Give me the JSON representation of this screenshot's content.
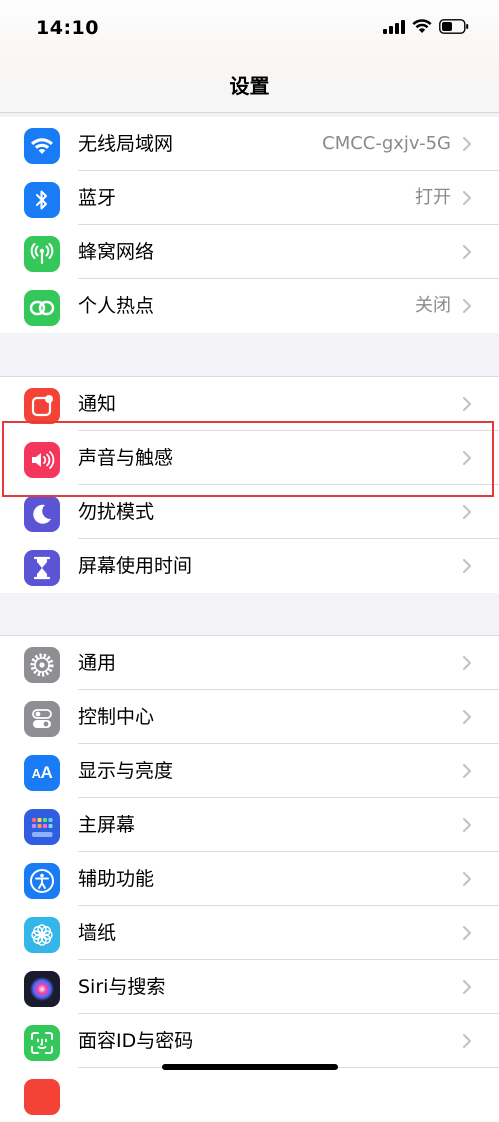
{
  "status": {
    "time": "14:10"
  },
  "nav": {
    "title": "设置"
  },
  "group1": [
    {
      "label": "无线局域网",
      "value": "CMCC-gxjv-5G",
      "icon": "wifi-icon",
      "color": "#1a7cf5"
    },
    {
      "label": "蓝牙",
      "value": "打开",
      "icon": "bluetooth-icon",
      "color": "#1a7cf5"
    },
    {
      "label": "蜂窝网络",
      "value": "",
      "icon": "antenna-icon",
      "color": "#34c759"
    },
    {
      "label": "个人热点",
      "value": "关闭",
      "icon": "hotspot-icon",
      "color": "#34c759"
    }
  ],
  "group2": [
    {
      "label": "通知",
      "icon": "notification-icon",
      "color": "#f44236"
    },
    {
      "label": "声音与触感",
      "icon": "speaker-icon",
      "color": "#f5365c"
    },
    {
      "label": "勿扰模式",
      "icon": "moon-icon",
      "color": "#5b55d6"
    },
    {
      "label": "屏幕使用时间",
      "icon": "hourglass-icon",
      "color": "#5b55d6"
    }
  ],
  "group3": [
    {
      "label": "通用",
      "icon": "gear-icon",
      "color": "#8e8e93"
    },
    {
      "label": "控制中心",
      "icon": "toggles-icon",
      "color": "#8e8e93"
    },
    {
      "label": "显示与亮度",
      "icon": "text-size-icon",
      "color": "#1a7cf5"
    },
    {
      "label": "主屏幕",
      "icon": "home-grid-icon",
      "color": "#2f5fe0"
    },
    {
      "label": "辅助功能",
      "icon": "accessibility-icon",
      "color": "#1a7cf5"
    },
    {
      "label": "墙纸",
      "icon": "flower-icon",
      "color": "#35b6e8"
    },
    {
      "label": "Siri与搜索",
      "icon": "siri-icon",
      "color": "#222"
    },
    {
      "label": "面容ID与密码",
      "icon": "face-id-icon",
      "color": "#34c759"
    }
  ]
}
